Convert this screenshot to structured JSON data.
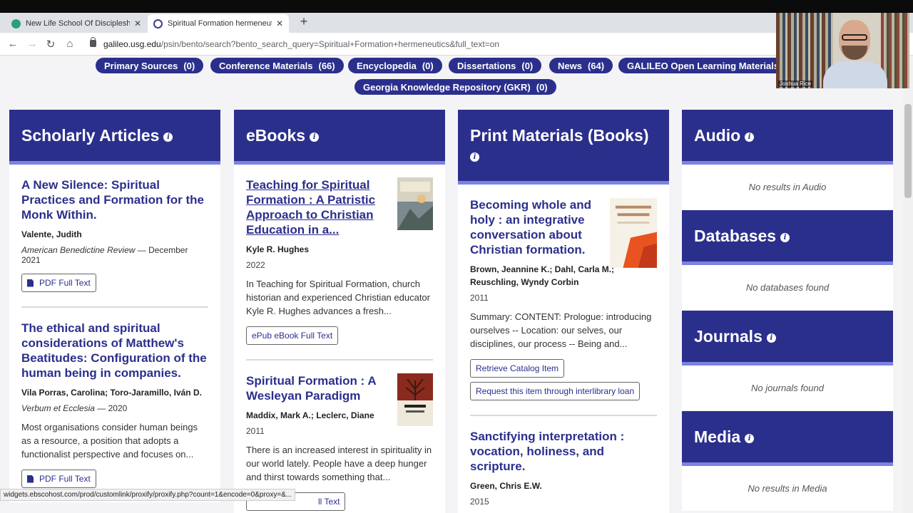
{
  "browser": {
    "tabs": [
      {
        "label": "New Life School Of Discipleship"
      },
      {
        "label": "Spiritual Formation hermeneutic"
      }
    ],
    "url_host": "galileo.usg.edu",
    "url_path": "/psin/bento/search?bento_search_query=Spiritual+Formation+hermeneutics&full_text=on",
    "status_url": "widgets.ebscohost.com/prod/customlink/proxify/proxify.php?count=1&encode=0&proxy=&..."
  },
  "video": {
    "name": "Joshua Rice"
  },
  "filters": [
    {
      "label": "Primary Sources",
      "count": "(0)"
    },
    {
      "label": "Conference Materials",
      "count": "(66)"
    },
    {
      "label": "Encyclopedia",
      "count": "(0)"
    },
    {
      "label": "Dissertations",
      "count": "(0)"
    },
    {
      "label": "News",
      "count": "(64)"
    },
    {
      "label": "GALILEO Open Learning Materials",
      "count": ""
    },
    {
      "label": "Georgia Knowledge Repository (GKR)",
      "count": "(0)"
    }
  ],
  "scholarly": {
    "title": "Scholarly Articles",
    "items": [
      {
        "title": "A New Silence: Spiritual Practices and Formation for the Monk Within.",
        "author": "Valente, Judith",
        "journal": "American Benedictine Review",
        "date": " — December 2021",
        "button": "PDF Full Text"
      },
      {
        "title": "The ethical and spiritual considerations of Matthew's Beatitudes: Configuration of the human being in companies.",
        "author": "Vila Porras, Carolina; Toro-Jaramillo, Iván D.",
        "journal": "Verbum et Ecclesia",
        "date": " — 2020",
        "desc": "Most organisations consider human beings as a resource, a position that adopts a functionalist perspective and focuses on...",
        "button": "PDF Full Text"
      }
    ]
  },
  "ebooks": {
    "title": "eBooks",
    "items": [
      {
        "title": "Teaching for Spiritual Formation : A Patristic Approach to Christian Education in a...",
        "author": "Kyle R. Hughes",
        "year": "2022",
        "desc": "In Teaching for Spiritual Formation, church historian and experienced Christian educator Kyle R. Hughes advances a fresh...",
        "button": "ePub eBook Full Text"
      },
      {
        "title": "Spiritual Formation : A Wesleyan Paradigm",
        "author": "Maddix, Mark A.; Leclerc, Diane",
        "year": "2011",
        "desc": "There is an increased interest in spirituality in our world lately. People have a deep hunger and thirst towards something that...",
        "button": "ll Text"
      }
    ]
  },
  "print": {
    "title": "Print Materials (Books)",
    "items": [
      {
        "title": "Becoming whole and holy : an integrative conversation about Christian formation.",
        "author": "Brown, Jeannine K.; Dahl, Carla M.; Reuschling, Wyndy Corbin",
        "year": "2011",
        "desc": "Summary: CONTENT: Prologue: introducing ourselves -- Location: our selves, our disciplines, our process -- Being and...",
        "button1": "Retrieve Catalog Item",
        "button2": "Request this item through interlibrary loan"
      },
      {
        "title": "Sanctifying interpretation : vocation, holiness, and scripture.",
        "author": "Green, Chris E.W.",
        "year": "2015"
      }
    ]
  },
  "side": [
    {
      "title": "Audio",
      "empty": "No results in Audio"
    },
    {
      "title": "Databases",
      "empty": "No databases found"
    },
    {
      "title": "Journals",
      "empty": "No journals found"
    },
    {
      "title": "Media",
      "empty": "No results in Media"
    }
  ],
  "colors": {
    "accent": "#2b2f8c",
    "underline": "#7b82e0"
  }
}
